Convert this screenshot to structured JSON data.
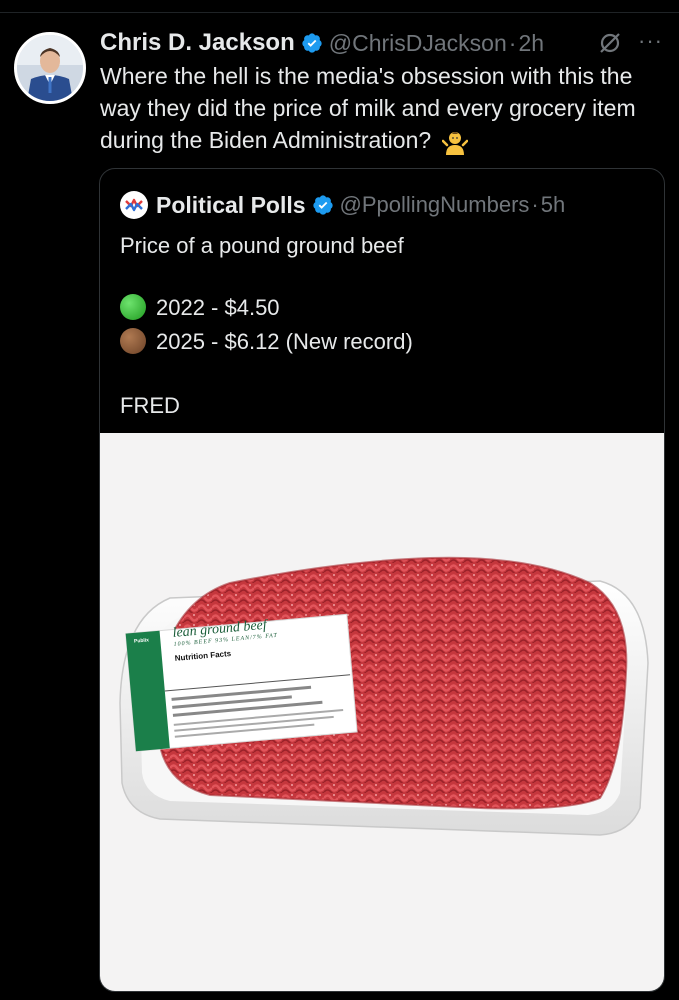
{
  "tweet": {
    "author_name": "Chris D. Jackson",
    "handle": "@ChrisDJackson",
    "separator": "·",
    "time": "2h",
    "text": "Where the hell is the media's obsession with this the way they did the price of milk and every grocery item during the Biden Administration?",
    "emoji": "person-shrugging-emoji"
  },
  "quoted": {
    "author_name": "Political Polls",
    "handle": "@PpollingNumbers",
    "separator": "·",
    "time": "5h",
    "line1": "Price of a pound ground beef",
    "line2": "2022 - $4.50",
    "line3": "2025 - $6.12 (New record)",
    "line4": "FRED",
    "line2_emoji_color": "#2bb52b",
    "line3_emoji_color": "#8a5a3b"
  },
  "image": {
    "label_brand": "Publix",
    "label_title": "lean ground beef",
    "label_subtitle": "100% BEEF 93% LEAN/7% FAT",
    "label_facts": "Nutrition Facts"
  },
  "colors": {
    "verified_blue": "#1d9bf0",
    "background": "#000000",
    "secondary_text": "#71767b"
  }
}
